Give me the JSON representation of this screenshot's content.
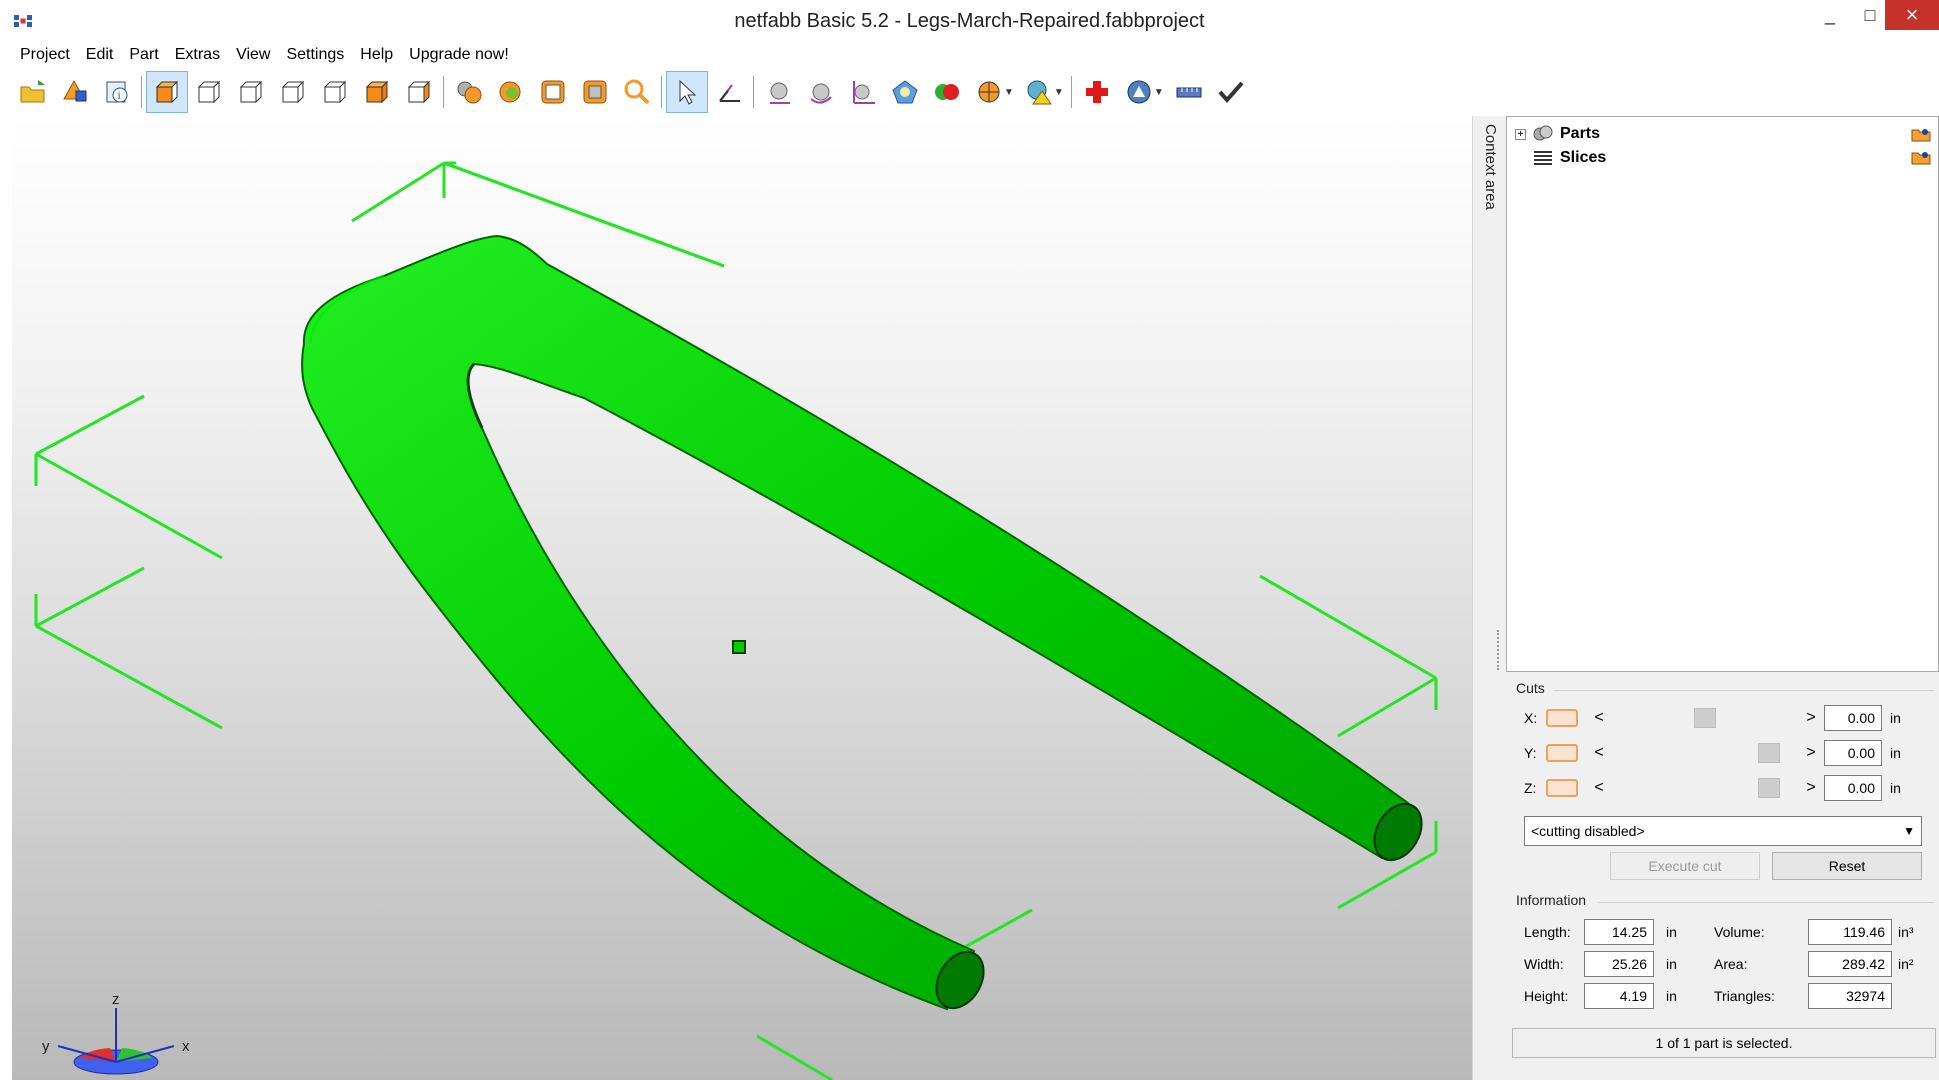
{
  "window": {
    "title": "netfabb Basic 5.2 - Legs-March-Repaired.fabbproject",
    "minimize": "_",
    "maximize": "□",
    "close": "×"
  },
  "menu": [
    "Project",
    "Edit",
    "Part",
    "Extras",
    "View",
    "Settings",
    "Help",
    "Upgrade now!"
  ],
  "toolbar": {
    "icons": [
      "open-project-icon",
      "add-part-icon",
      "part-info-icon",
      "view-iso-icon",
      "view-front-icon",
      "view-back-icon",
      "view-left-icon",
      "view-right-icon",
      "view-top-icon",
      "view-bottom-icon",
      "shading-icon",
      "color-parts-icon",
      "wireframe-icon",
      "section-view-icon",
      "zoom-icon",
      "select-pointer-icon",
      "move-tool-icon",
      "mesh-sphere-icon",
      "rotate-icon",
      "measure-axes-icon",
      "transform-icon",
      "boolean-icon",
      "pie-menu-icon",
      "report-warning-icon",
      "repair-cross-icon",
      "analysis-icon",
      "ruler-icon",
      "checkmark-icon"
    ],
    "active": "view-iso-icon"
  },
  "context_area": {
    "label": "Context area"
  },
  "tree": {
    "items": [
      {
        "label": "Parts",
        "expander": "+"
      },
      {
        "label": "Slices"
      }
    ]
  },
  "cuts": {
    "title": "Cuts",
    "rows": [
      {
        "axis": "X:",
        "value": "0.00",
        "unit": "in",
        "thumb_pos": 0.5
      },
      {
        "axis": "Y:",
        "value": "0.00",
        "unit": "in",
        "thumb_pos": 0.88
      },
      {
        "axis": "Z:",
        "value": "0.00",
        "unit": "in",
        "thumb_pos": 0.88
      }
    ],
    "left_arrow": "<",
    "right_arrow": ">",
    "mode": "<cutting disabled>",
    "execute_label": "Execute cut",
    "reset_label": "Reset"
  },
  "information": {
    "title": "Information",
    "rows": [
      {
        "label": "Length:",
        "value": "14.25",
        "unit": "in",
        "label2": "Volume:",
        "value2": "119.46",
        "unit2": "in³"
      },
      {
        "label": "Width:",
        "value": "25.26",
        "unit": "in",
        "label2": "Area:",
        "value2": "289.42",
        "unit2": "in²"
      },
      {
        "label": "Height:",
        "value": "4.19",
        "unit": "in",
        "label2": "Triangles:",
        "value2": "32974",
        "unit2": ""
      }
    ]
  },
  "status": "1 of 1 part is selected.",
  "axes": {
    "z": "z",
    "y": "y",
    "x": "x"
  },
  "colors": {
    "part": "#00d400",
    "bbox": "#22e622",
    "accent": "#cfe6fb",
    "close": "#c7312c"
  }
}
